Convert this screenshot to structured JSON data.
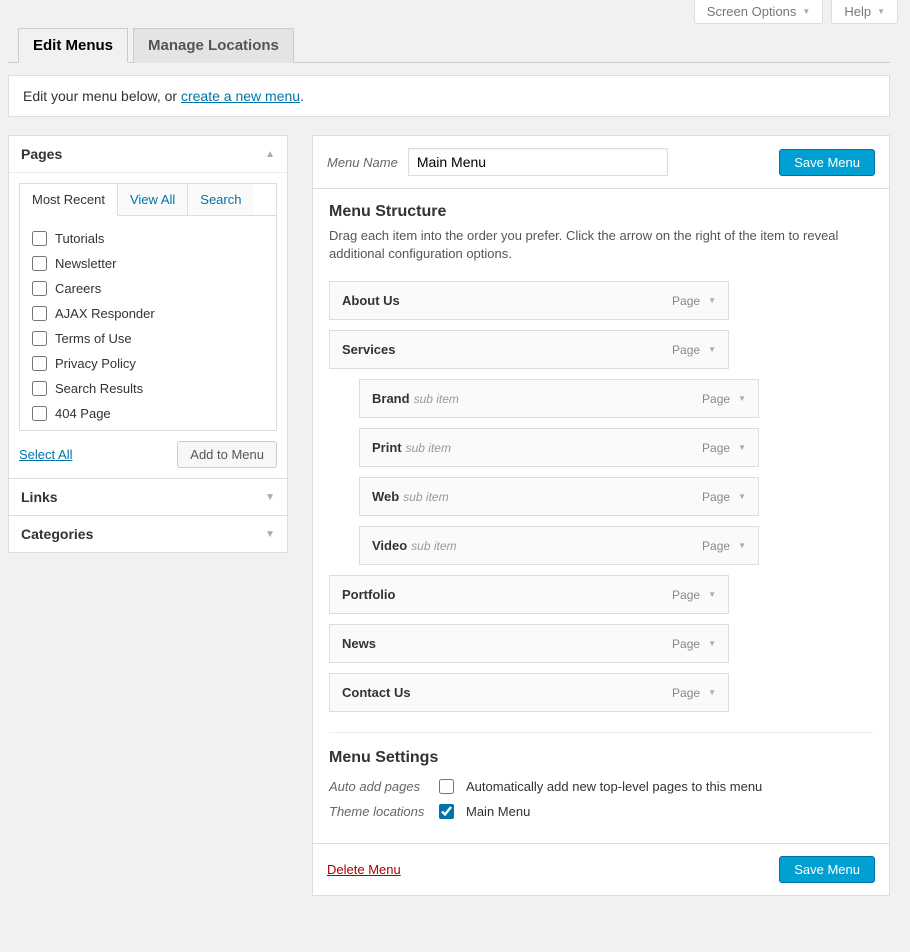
{
  "screen_meta": {
    "screen_options": "Screen Options",
    "help": "Help"
  },
  "tabs": {
    "edit": "Edit Menus",
    "manage": "Manage Locations"
  },
  "intro": {
    "prefix": "Edit your menu below, or ",
    "link": "create a new menu",
    "suffix": "."
  },
  "sidebar": {
    "pages": {
      "title": "Pages",
      "tabs": {
        "recent": "Most Recent",
        "view_all": "View All",
        "search": "Search"
      },
      "items": [
        "Tutorials",
        "Newsletter",
        "Careers",
        "AJAX Responder",
        "Terms of Use",
        "Privacy Policy",
        "Search Results",
        "404 Page"
      ],
      "select_all": "Select All",
      "add_to_menu": "Add to Menu"
    },
    "links": {
      "title": "Links"
    },
    "categories": {
      "title": "Categories"
    }
  },
  "menu": {
    "name_label": "Menu Name",
    "name_value": "Main Menu",
    "save": "Save Menu",
    "structure_title": "Menu Structure",
    "structure_desc": "Drag each item into the order you prefer. Click the arrow on the right of the item to reveal additional configuration options.",
    "item_type": "Page",
    "sub_label": "sub item",
    "items": [
      {
        "label": "About Us",
        "sub": false
      },
      {
        "label": "Services",
        "sub": false
      },
      {
        "label": "Brand",
        "sub": true
      },
      {
        "label": "Print",
        "sub": true
      },
      {
        "label": "Web",
        "sub": true
      },
      {
        "label": "Video",
        "sub": true
      },
      {
        "label": "Portfolio",
        "sub": false
      },
      {
        "label": "News",
        "sub": false
      },
      {
        "label": "Contact Us",
        "sub": false
      }
    ],
    "settings": {
      "title": "Menu Settings",
      "auto_label": "Auto add pages",
      "auto_text": "Automatically add new top-level pages to this menu",
      "theme_label": "Theme locations",
      "theme_text": "Main Menu"
    },
    "delete": "Delete Menu"
  }
}
